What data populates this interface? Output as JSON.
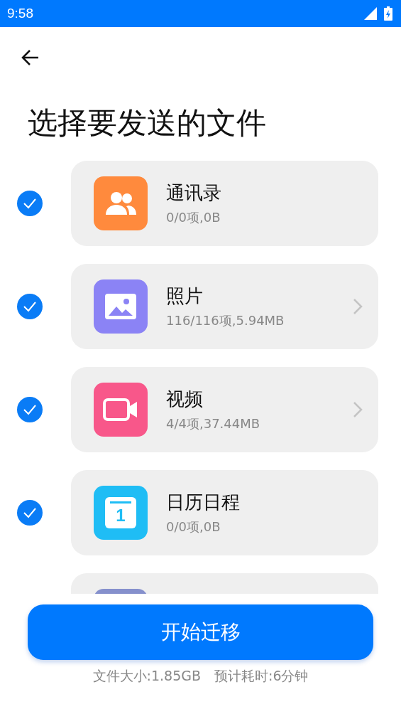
{
  "status_bar": {
    "time": "9:58"
  },
  "title": "选择要发送的文件",
  "items": [
    {
      "kind": "contacts",
      "color": "#ff8a3d",
      "name": "通讯录",
      "detail": "0/0项,0B",
      "checked": true,
      "has_arrow": false
    },
    {
      "kind": "photos",
      "color": "#8b83f5",
      "name": "照片",
      "detail": "116/116项,5.94MB",
      "checked": true,
      "has_arrow": true
    },
    {
      "kind": "video",
      "color": "#f8578a",
      "name": "视频",
      "detail": "4/4项,37.44MB",
      "checked": true,
      "has_arrow": true
    },
    {
      "kind": "calendar",
      "color": "#1fbdf5",
      "name": "日历日程",
      "detail": "0/0项,0B",
      "checked": true,
      "has_arrow": false,
      "icon_text": "1"
    },
    {
      "kind": "apps",
      "color": "#8590cc"
    }
  ],
  "button": "开始迁移",
  "summary": "文件大小:1.85GB　预计耗时:6分钟"
}
